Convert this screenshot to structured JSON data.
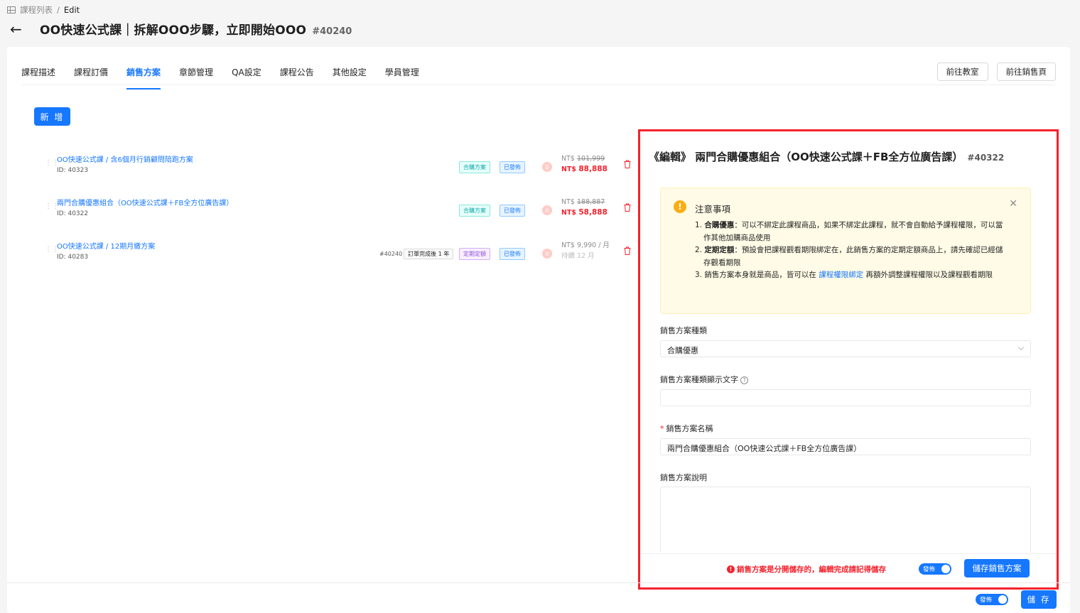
{
  "breadcrumb": {
    "parent": "課程列表",
    "sep": "/",
    "current": "Edit"
  },
  "page": {
    "title": "OO快速公式課｜拆解OOO步驟，立即開始OOO",
    "id": "#40240"
  },
  "tabs": [
    "課程描述",
    "課程訂價",
    "銷售方案",
    "章節管理",
    "QA設定",
    "課程公告",
    "其他設定",
    "學員管理"
  ],
  "active_tab": "銷售方案",
  "top_buttons": {
    "classroom": "前往教室",
    "sales_page": "前往銷售頁"
  },
  "add_button": "新 增",
  "plans": [
    {
      "name": "OO快速公式課 / 含6個月行銷顧問陪跑方案",
      "id": "ID: 40323",
      "tag_type": "合購方案",
      "tag_status": "已發佈",
      "badge": "0",
      "price_label": "NT$",
      "price_orig": "101,999",
      "price_sale_label": "NT$",
      "price_sale": "88,888"
    },
    {
      "name": "兩門合購優惠組合（OO快速公式課＋FB全方位廣告課）",
      "id": "ID: 40322",
      "tag_type": "合購方案",
      "tag_status": "已發佈",
      "badge": "0",
      "price_label": "NT$",
      "price_orig": "188,887",
      "price_sale_label": "NT$",
      "price_sale": "58,888"
    },
    {
      "name": "OO快速公式課 / 12期月繳方案",
      "id": "ID: 40283",
      "extra_ref": "#40240",
      "extra_cond": "訂單完成後 1 年",
      "tag_type": "定期定額",
      "tag_status": "已發佈",
      "badge": "0",
      "price_label": "NT$",
      "price_main": "9,990 / 月",
      "price_sub": "持續 12 月"
    }
  ],
  "edit": {
    "title": "《編輯》 兩門合購優惠組合（OO快速公式課＋FB全方位廣告課）",
    "id": "#40322",
    "notice": {
      "title": "注意事項",
      "items": [
        {
          "num": "1.",
          "bold": "合購優惠",
          "text": "：可以不綁定此課程商品，如果不綁定此課程，就不會自動給予課程權限，可以當作其他加購商品使用"
        },
        {
          "num": "2.",
          "bold": "定期定額",
          "text": "：預設會把課程觀看期限綁定在，此銷售方案的定期定額商品上，請先確認已經儲存觀看期限"
        },
        {
          "num": "3.",
          "pre": "銷售方案本身就是商品，皆可以在 ",
          "link": "課程權限綁定",
          "post": " 再額外調整課程權限以及課程觀看期限"
        }
      ]
    },
    "fields": {
      "type_label": "銷售方案種類",
      "type_value": "合購優惠",
      "display_label": "銷售方案種類顯示文字",
      "display_value": "",
      "name_label": "銷售方案名稱",
      "name_value": "兩門合購優惠組合（OO快速公式課＋FB全方位廣告課）",
      "desc_label": "銷售方案說明"
    },
    "unsaved_msg": "銷售方案是分開儲存的，編輯完成請記得儲存",
    "publish_toggle": "發佈",
    "save_button": "儲存銷售方案"
  },
  "footer": {
    "publish_toggle": "發佈",
    "save_button": "儲 存"
  },
  "colors": {
    "primary": "#1677ff",
    "danger": "#f5222d",
    "highlight_border": "#f5222d"
  }
}
